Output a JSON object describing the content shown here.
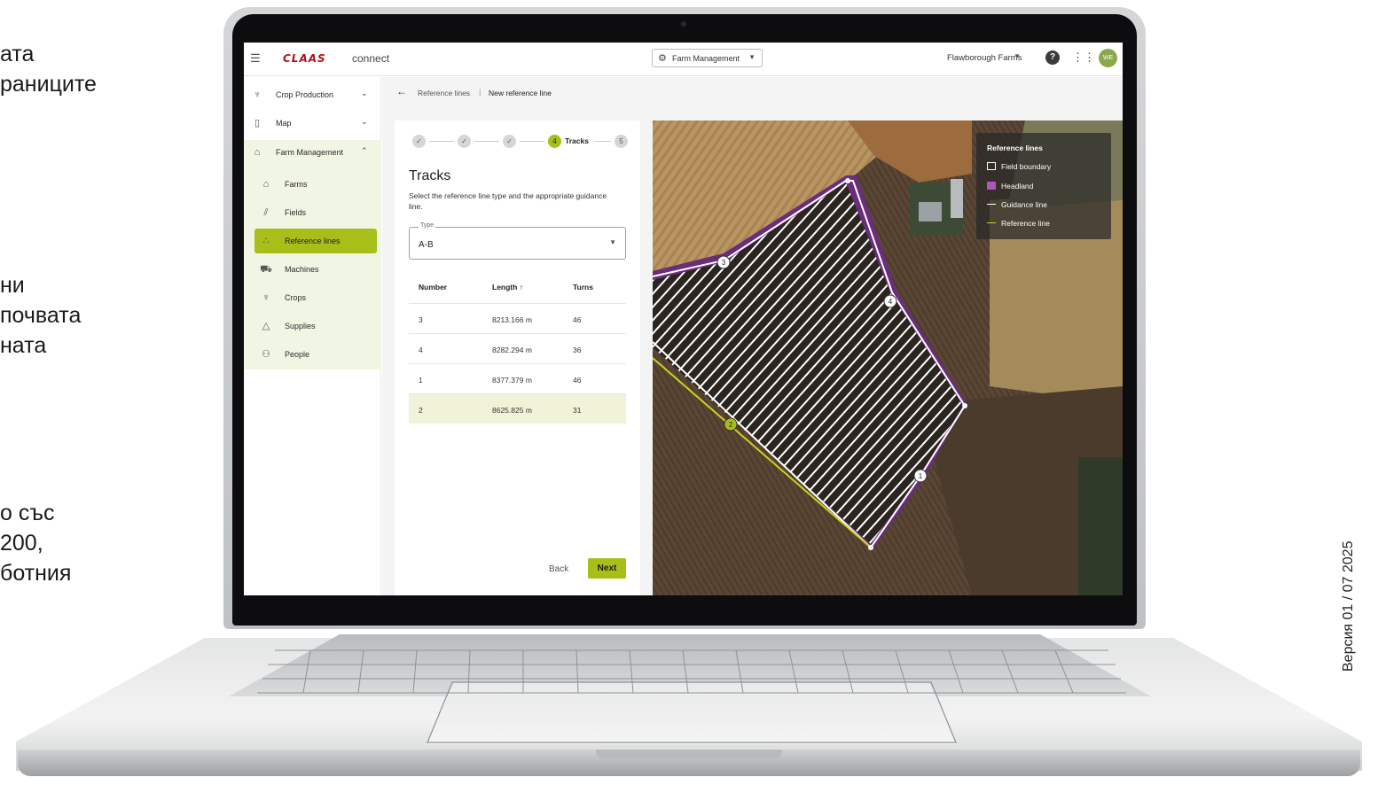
{
  "slide": {
    "fragments": [
      "ата",
      "раниците",
      "ни",
      "почвата",
      "ната",
      "о със",
      " 200,",
      "ботния"
    ],
    "version": "Версия 01 / 07 2025"
  },
  "topbar": {
    "brand": "CLAAS",
    "product": "connect",
    "module": "Farm Management",
    "farm": "Flawborough Farms",
    "help_glyph": "?",
    "avatar_initials": "WE"
  },
  "sidebar": {
    "items": [
      {
        "label": "Crop Production",
        "icon": "wheat-icon"
      },
      {
        "label": "Map",
        "icon": "map-icon"
      },
      {
        "label": "Farm Management",
        "icon": "farm-icon"
      }
    ],
    "subitems": [
      {
        "label": "Farms",
        "icon": "farm-icon"
      },
      {
        "label": "Fields",
        "icon": "fields-icon"
      },
      {
        "label": "Reference lines",
        "icon": "reference-lines-icon"
      },
      {
        "label": "Machines",
        "icon": "tractor-icon"
      },
      {
        "label": "Crops",
        "icon": "wheat-icon"
      },
      {
        "label": "Supplies",
        "icon": "supplies-icon"
      },
      {
        "label": "People",
        "icon": "people-icon"
      }
    ],
    "active": "Reference lines"
  },
  "breadcrumb": {
    "parent": "Reference lines",
    "separator": "|",
    "current": "New reference line"
  },
  "wizard": {
    "steps": [
      {
        "label": "",
        "state": "done"
      },
      {
        "label": "",
        "state": "done"
      },
      {
        "label": "",
        "state": "done"
      },
      {
        "label": "Tracks",
        "number": "4",
        "state": "current"
      },
      {
        "label": "",
        "number": "5",
        "state": "todo"
      }
    ],
    "title": "Tracks",
    "description": "Select the reference line type and the appropriate guidance line.",
    "type_label": "Type",
    "type_value": "A-B",
    "back_label": "Back",
    "next_label": "Next"
  },
  "tracks_table": {
    "columns": [
      "Number",
      "Length ↑",
      "Turns"
    ],
    "rows": [
      {
        "number": "3",
        "length": "8213.166 m",
        "turns": "46",
        "selected": false
      },
      {
        "number": "4",
        "length": "8282.294 m",
        "turns": "36",
        "selected": false
      },
      {
        "number": "1",
        "length": "8377.379 m",
        "turns": "46",
        "selected": false
      },
      {
        "number": "2",
        "length": "8625.825 m",
        "turns": "31",
        "selected": true
      }
    ]
  },
  "map": {
    "legend_title": "Reference lines",
    "legend": [
      {
        "label": "Field boundary",
        "color": "#ffffff"
      },
      {
        "label": "Headland",
        "color": "#b056b8"
      },
      {
        "label": "Guidance line",
        "color": "#ffffff"
      },
      {
        "label": "Reference line",
        "color": "#c8d21e"
      }
    ],
    "markers": [
      "1",
      "2",
      "3",
      "4"
    ]
  },
  "colors": {
    "accent": "#a8bf1a",
    "brand": "#b0121c",
    "headland": "#6a2c7c"
  }
}
